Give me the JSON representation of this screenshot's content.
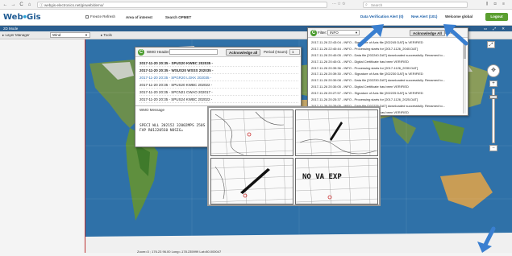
{
  "browser": {
    "url": "webgis-electronics.net/gisweb/demo/",
    "search_placeholder": "Search",
    "back_icon": "←",
    "forward_icon": "→",
    "reload_icon": "C",
    "home_icon": "⌂",
    "bar_icons": "··· ☆ ✩",
    "right_icons": "⫼ ⊡ ≡"
  },
  "header": {
    "logo_main": "Web",
    "logo_dot": "●",
    "logo_suffix": "Gis",
    "freeze_label": "Freeze Refresh",
    "area_label": "Area of interest",
    "search_label": "Search OPMET",
    "data_alert": "Data Verification Alert (0)",
    "new_alert": "New Alert (101)",
    "welcome": "Welcome global",
    "logout": "Logout"
  },
  "mode_row": {
    "label": "2D Mode",
    "icons": "▭ ⤢ ✕"
  },
  "layer_row": {
    "label": "▸ Layer Manager",
    "select_value": "Wind",
    "tools_label": "▸ Tools"
  },
  "map": {
    "footer": "Zoom=3 ; 176.23 96.00  Long=-178.235999 Lat=80.000047"
  },
  "wmo_window": {
    "header_label": "WMO Header:",
    "ack_label": "Acknowledge all",
    "period_label": "Period (Hours):",
    "period_value": "1",
    "rows": [
      {
        "text": "2017-11-20 20:35 - SPUS20 KWBC 202035 -",
        "style": "bold"
      },
      {
        "text": "2017-11-20 20:35 - WSUS20 WSSS 202035 -",
        "style": "bold"
      },
      {
        "text": "2017-11-20 20:35 - SPGR20 LGKK 202035 -",
        "style": "blue"
      },
      {
        "text": "2017-11-20 20:35 - SPUS20 KWBC 202022 -",
        "style": ""
      },
      {
        "text": "2017-11-20 20:35 - SPCN21 CWAO 202017 -",
        "style": ""
      },
      {
        "text": "2017-11-20 20:35 - SPUS24 KWBC 202022 -",
        "style": ""
      }
    ],
    "msg_label": "WMO Message",
    "msg_text": "SPECI WLL 202152 32002MPS 250S FAP R012205S0 NOSIG="
  },
  "alert_window": {
    "filter_label": "Filter:",
    "filter_value": "INFO",
    "ack_label": "Acknowledge All",
    "period_label": "Peri",
    "rows": [
      "2017-11-26 22:43:04 - INFO - Signature of Axis file [202245 DAT] is VERIFIED",
      "2017-11-26 22:40:44 - INFO - Processing starts for [2017-1126_2040.DAT]",
      "2017-11-26 20:40:05 - INFO - Data file [202240.DAT] downloaded successfully. Renamed to...",
      "2017-11-26 20:40:01 - INFO - Digital Certificate has been VERIFIED",
      "2017-11-26 20:39:36 - INFO - Processing starts for [2017-1126_2030.DAT]",
      "2017-11-26 20:39:30 - INFO - Signature of Axis file [202230 DAT] is VERIFIED",
      "2017-11-26 20:30:08 - INFO - Data file [202230.DAT] downloaded successfully. Renamed to...",
      "2017-11-26 20:30:05 - INFO - Digital Certificate has been VERIFIED",
      "2017-11-26 20:27:57 - INFO - Signature of Axis file [202225 DAT] is VERIFIED",
      "2017-11-26 20:25:37 - INFO - Processing starts for [2017-1126_2025.DAT]",
      "2017-11-26 20:25:05 - INFO - Data file [202225.DAT] downloaded successfully. Renamed to...",
      "2017-11-26 20:25:01 - INFO - Digital Certificate has been VERIFIED"
    ]
  },
  "image_panel": {
    "nova_text": "NO VA EXP"
  },
  "colors": {
    "ocean": "#2e6fa6",
    "arrow": "#3a7fd0",
    "logout_bg": "#5a9e2f"
  },
  "icons": [
    "back-icon",
    "forward-icon",
    "reload-icon",
    "home-icon",
    "lock-icon",
    "search-icon",
    "refresh-icon",
    "compass-icon",
    "zoom-plus-icon",
    "zoom-minus-icon",
    "fullscreen-icon"
  ]
}
